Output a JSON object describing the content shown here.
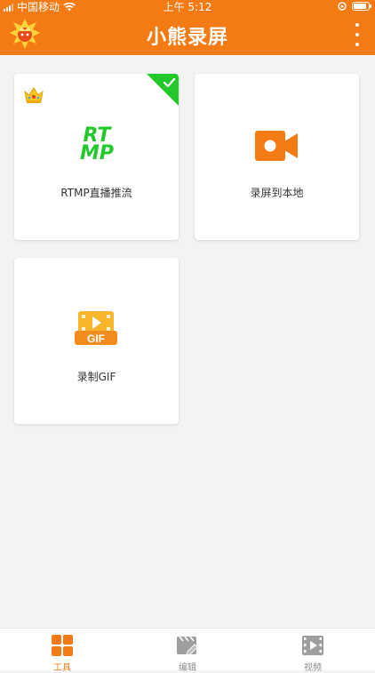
{
  "status_bar": {
    "carrier": "中国移动",
    "time": "上午 5:12"
  },
  "header": {
    "title": "小熊录屏"
  },
  "cards": [
    {
      "label": "RTMP直播推流",
      "icon_text_top": "RT",
      "icon_text_bottom": "MP",
      "selected": true,
      "premium": true
    },
    {
      "label": "录屏到本地"
    },
    {
      "label": "录制GIF",
      "icon_text": "GIF"
    }
  ],
  "tabs": [
    {
      "label": "工具",
      "active": true
    },
    {
      "label": "编辑"
    },
    {
      "label": "视频"
    }
  ],
  "colors": {
    "accent": "#f47a14",
    "selected_green": "#22c92b",
    "gif_yellow": "#f7b52b"
  }
}
